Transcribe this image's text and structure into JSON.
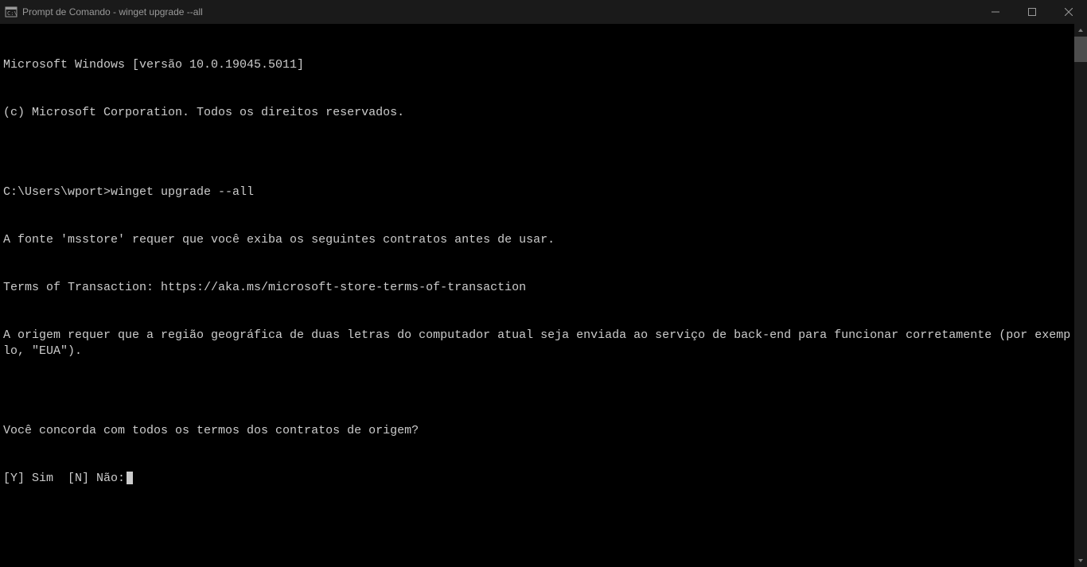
{
  "window": {
    "title": "Prompt de Comando - winget  upgrade --all"
  },
  "terminal": {
    "lines": [
      "Microsoft Windows [versão 10.0.19045.5011]",
      "(c) Microsoft Corporation. Todos os direitos reservados.",
      "",
      "C:\\Users\\wport>winget upgrade --all",
      "A fonte 'msstore' requer que você exiba os seguintes contratos antes de usar.",
      "Terms of Transaction: https://aka.ms/microsoft-store-terms-of-transaction",
      "A origem requer que a região geográfica de duas letras do computador atual seja enviada ao serviço de back-end para funcionar corretamente (por exemplo, \"EUA\").",
      "",
      "Você concorda com todos os termos dos contratos de origem?",
      "[Y] Sim  [N] Não:"
    ]
  }
}
